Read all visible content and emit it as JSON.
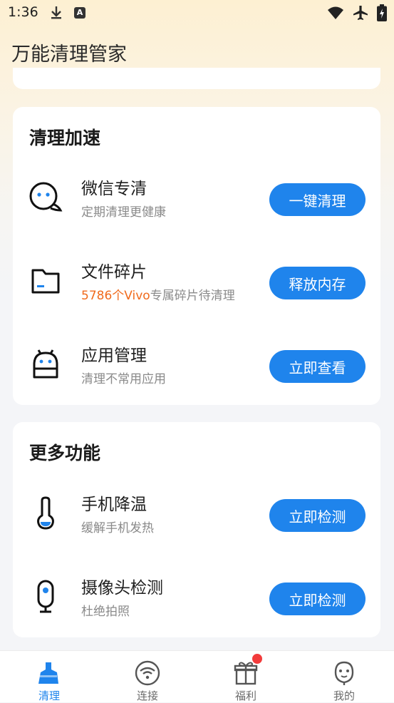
{
  "status_bar": {
    "time": "1:36",
    "a_badge": "A"
  },
  "app": {
    "title": "万能清理管家"
  },
  "clean_section": {
    "title": "清理加速",
    "items": [
      {
        "name": "微信专清",
        "desc": "定期清理更健康",
        "button": "一键清理",
        "icon": "wechat-chat-icon"
      },
      {
        "name": "文件碎片",
        "desc_highlight": "5786个Vivo",
        "desc_rest": "专属碎片待清理",
        "button": "释放内存",
        "icon": "folder-icon"
      },
      {
        "name": "应用管理",
        "desc": "清理不常用应用",
        "button": "立即查看",
        "icon": "android-icon"
      }
    ]
  },
  "more_section": {
    "title": "更多功能",
    "items": [
      {
        "name": "手机降温",
        "desc": "缓解手机发热",
        "button": "立即检测",
        "icon": "thermometer-icon"
      },
      {
        "name": "摄像头检测",
        "desc": "杜绝拍照",
        "button": "立即检测",
        "icon": "camera-icon"
      }
    ]
  },
  "tabs": [
    {
      "label": "清理",
      "icon": "broom-icon",
      "active": true
    },
    {
      "label": "连接",
      "icon": "wifi-icon",
      "active": false
    },
    {
      "label": "福利",
      "icon": "gift-icon",
      "active": false,
      "badge": true
    },
    {
      "label": "我的",
      "icon": "face-icon",
      "active": false
    }
  ],
  "colors": {
    "accent": "#1f84ec",
    "highlight": "#f06a1c",
    "badge": "#f23b3b"
  }
}
